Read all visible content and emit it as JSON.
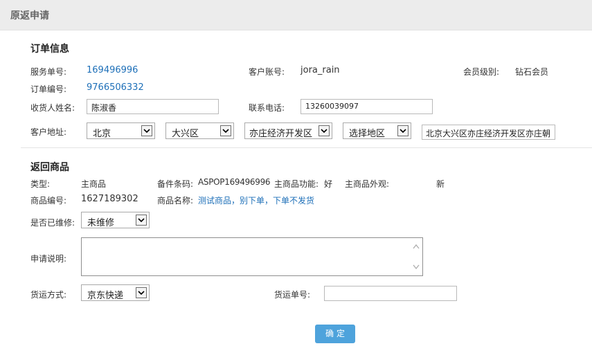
{
  "header": {
    "title": "原返申请"
  },
  "order_info": {
    "section_title": "订单信息",
    "service_no_label": "服务单号:",
    "service_no": "169496996",
    "customer_account_label": "客户账号:",
    "customer_account": "jora_rain",
    "member_level_label": "会员级别:",
    "member_level": "钻石会员",
    "order_no_label": "订单编号:",
    "order_no": "9766506332",
    "receiver_name_label": "收货人姓名:",
    "receiver_name": "陈淑香",
    "phone_label": "联系电话:",
    "phone": "13260039097",
    "address_label": "客户地址:",
    "province": "北京",
    "district": "大兴区",
    "town": "亦庄经济开发区",
    "area": "选择地区",
    "address_detail": "北京大兴区亦庄经济开发区亦庄朝"
  },
  "return_goods": {
    "section_title": "返回商品",
    "type_label": "类型:",
    "type_value": "主商品",
    "barcode_label": "备件条码:",
    "barcode_value": "ASPOP169496996",
    "function_label": "主商品功能:",
    "function_value": "好",
    "appearance_label": "主商品外观:",
    "appearance_value": "新",
    "product_no_label": "商品编号:",
    "product_no": "1627189302",
    "product_name_label": "商品名称:",
    "product_name": "测试商品，别下单，下单不发货",
    "repaired_label": "是否已维修:",
    "repaired_value": "未维修",
    "description_label": "申请说明:",
    "description_value": "",
    "shipping_method_label": "货运方式:",
    "shipping_method": "京东快递",
    "shipping_no_label": "货运单号:",
    "shipping_no": ""
  },
  "actions": {
    "confirm": "确定"
  }
}
